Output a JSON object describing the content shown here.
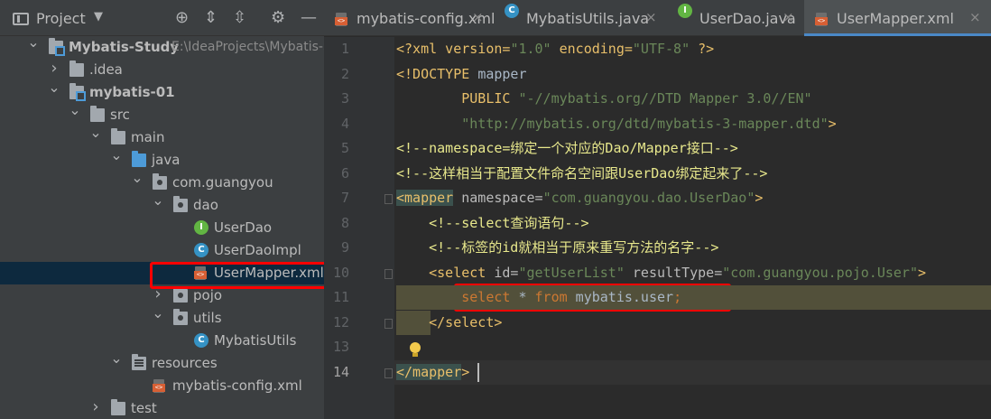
{
  "project_panel": {
    "title": "Project",
    "tree": [
      {
        "label": "Mybatis-Study",
        "path": "E:\\IdeaProjects\\Mybatis-S",
        "bold": true,
        "icon": "module-folder-icon",
        "arrow": "down",
        "depth": 0
      },
      {
        "label": ".idea",
        "icon": "folder-icon",
        "arrow": "right",
        "depth": 1
      },
      {
        "label": "mybatis-01",
        "bold": true,
        "icon": "module-folder-icon",
        "arrow": "down",
        "depth": 1
      },
      {
        "label": "src",
        "icon": "folder-icon",
        "arrow": "down",
        "depth": 2
      },
      {
        "label": "main",
        "icon": "folder-icon",
        "arrow": "down",
        "depth": 3
      },
      {
        "label": "java",
        "icon": "source-folder-icon",
        "arrow": "down",
        "depth": 4
      },
      {
        "label": "com.guangyou",
        "icon": "package-icon",
        "arrow": "down",
        "depth": 5
      },
      {
        "label": "dao",
        "icon": "package-icon",
        "arrow": "down",
        "depth": 6
      },
      {
        "label": "UserDao",
        "icon": "interface-icon",
        "arrow": "",
        "depth": 7
      },
      {
        "label": "UserDaoImpl",
        "icon": "class-icon",
        "arrow": "",
        "depth": 7
      },
      {
        "label": "UserMapper.xml",
        "icon": "xml-file-icon",
        "arrow": "",
        "depth": 7,
        "selected": true
      },
      {
        "label": "pojo",
        "icon": "package-icon",
        "arrow": "right",
        "depth": 6
      },
      {
        "label": "utils",
        "icon": "package-icon",
        "arrow": "down",
        "depth": 6
      },
      {
        "label": "MybatisUtils",
        "icon": "class-icon",
        "arrow": "",
        "depth": 7
      },
      {
        "label": "resources",
        "icon": "resources-folder-icon",
        "arrow": "down",
        "depth": 4
      },
      {
        "label": "mybatis-config.xml",
        "icon": "xml-file-icon",
        "arrow": "",
        "depth": 5
      },
      {
        "label": "test",
        "icon": "folder-icon",
        "arrow": "right",
        "depth": 3
      }
    ]
  },
  "tabs": [
    {
      "label": "mybatis-config.xml",
      "icon": "xml-file-icon",
      "active": false
    },
    {
      "label": "MybatisUtils.java",
      "icon": "class-icon",
      "active": false
    },
    {
      "label": "UserDao.java",
      "icon": "interface-icon",
      "active": false
    },
    {
      "label": "UserMapper.xml",
      "icon": "xml-file-icon",
      "active": true
    }
  ],
  "editor": {
    "line_numbers": [
      "1",
      "2",
      "3",
      "4",
      "5",
      "6",
      "7",
      "8",
      "9",
      "10",
      "11",
      "12",
      "13",
      "14"
    ],
    "current_line": "14",
    "lines": [
      [
        {
          "t": "<?xml version=",
          "c": "c-decl"
        },
        {
          "t": "\"1.0\"",
          "c": "c-str"
        },
        {
          "t": " encoding=",
          "c": "c-decl"
        },
        {
          "t": "\"UTF-8\"",
          "c": "c-str"
        },
        {
          "t": " ?>",
          "c": "c-decl"
        }
      ],
      [
        {
          "t": "<!DOCTYPE ",
          "c": "c-decl"
        },
        {
          "t": "mapper",
          "c": "c-text"
        }
      ],
      [
        {
          "t": "        PUBLIC ",
          "c": "c-decl"
        },
        {
          "t": "\"-//mybatis.org//DTD Mapper 3.0//EN\"",
          "c": "c-str"
        }
      ],
      [
        {
          "t": "        \"http://mybatis.org/dtd/mybatis-3-mapper.dtd\"",
          "c": "c-str"
        },
        {
          "t": ">",
          "c": "c-decl"
        }
      ],
      [
        {
          "t": "<!--namespace=绑定一个对应的Dao/Mapper接口-->",
          "c": "c-cmt-yellow"
        }
      ],
      [
        {
          "t": "<!--这样相当于配置文件命名空间跟UserDao绑定起来了-->",
          "c": "c-cmt-yellow"
        }
      ],
      [
        {
          "t": "<mapper",
          "c": "c-tag tag-bg"
        },
        {
          "t": " namespace=",
          "c": "c-attr"
        },
        {
          "t": "\"com.guangyou.dao.UserDao\"",
          "c": "c-attrval"
        },
        {
          "t": ">",
          "c": "c-tag"
        }
      ],
      [
        {
          "t": "    <!--select查询语句-->",
          "c": "c-cmt-yellow"
        }
      ],
      [
        {
          "t": "    <!--标签的id就相当于原来重写方法的名字-->",
          "c": "c-cmt-yellow"
        }
      ],
      [
        {
          "t": "    <select",
          "c": "c-tag"
        },
        {
          "t": " id=",
          "c": "c-attr"
        },
        {
          "t": "\"getUserList\"",
          "c": "c-attrval"
        },
        {
          "t": " resultType=",
          "c": "c-attr"
        },
        {
          "t": "\"com.guangyou.pojo.User\"",
          "c": "c-attrval"
        },
        {
          "t": ">",
          "c": "c-tag"
        }
      ],
      [
        {
          "t": "        select",
          "c": "c-sql-kw"
        },
        {
          "t": " * ",
          "c": "c-sql-id"
        },
        {
          "t": "from",
          "c": "c-sql-kw"
        },
        {
          "t": " mybatis.user",
          "c": "c-sql-id"
        },
        {
          "t": ";",
          "c": "c-sql-kw"
        }
      ],
      [
        {
          "t": "    </select>",
          "c": "c-tag"
        }
      ],
      [
        {
          "t": "",
          "c": "c-text"
        }
      ],
      [
        {
          "t": "</mapper",
          "c": "c-tag tag-bg"
        },
        {
          "t": ">",
          "c": "c-tag"
        }
      ]
    ]
  }
}
